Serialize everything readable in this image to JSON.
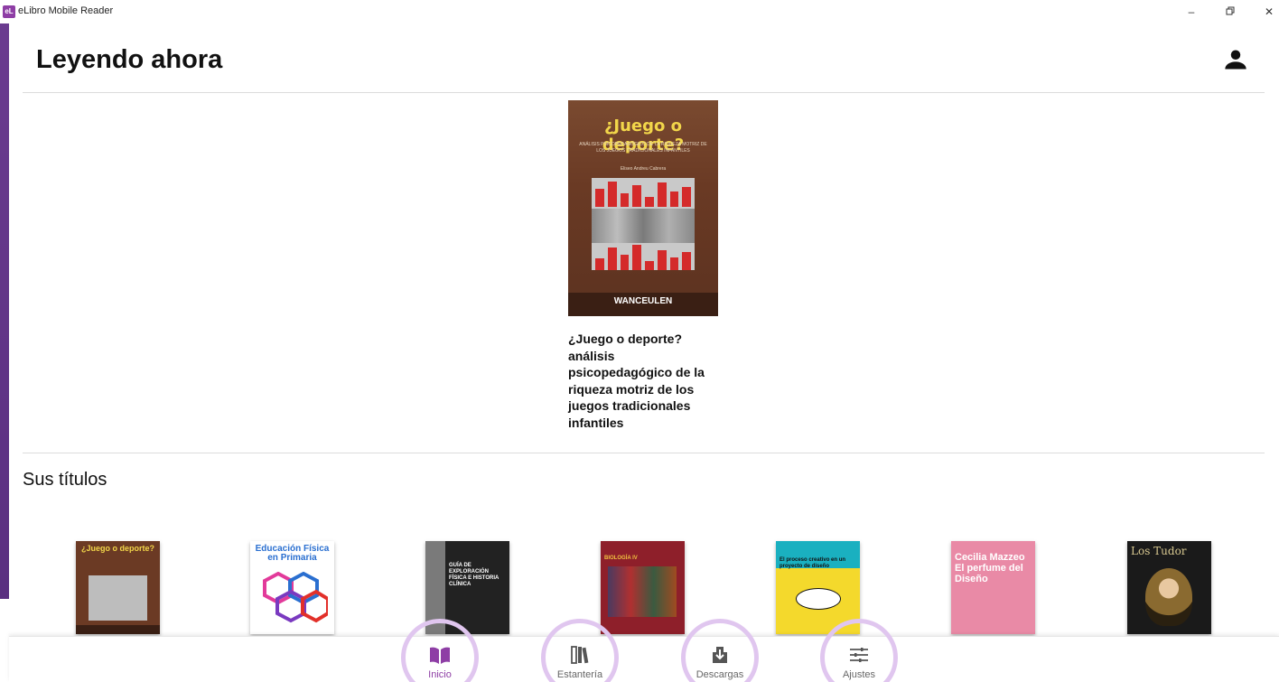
{
  "window": {
    "title": "eLibro Mobile Reader",
    "logo": "eL"
  },
  "header": {
    "title": "Leyendo ahora",
    "profile_icon": "person-icon"
  },
  "reading": {
    "cover_title": "¿Juego o deporte?",
    "cover_subtitle": "ANÁLISIS PSICOPEDAGÓGICO DE LA RIQUEZA MOTRIZ DE LOS JUEGOS TRADICIONALES INFANTILES",
    "cover_author": "Eliseo Andreu Cabrera",
    "cover_publisher": "WANCEULEN",
    "book_title": "¿Juego o deporte? análisis psicopedagógico de la riqueza motriz de los juegos tradicionales infantiles"
  },
  "titles_section": {
    "heading": "Sus títulos",
    "books": [
      {
        "cover_text": "¿Juego o deporte?",
        "color": "#6b3a24",
        "text_color": "#f2d64a"
      },
      {
        "cover_text": "Educación Física en Primaria",
        "color": "#ffffff",
        "text_color": "#2a6fd0"
      },
      {
        "cover_text": "GUÍA DE EXPLORACIÓN FÍSICA E HISTORIA CLÍNICA",
        "color": "#222222",
        "text_color": "#ffffff"
      },
      {
        "cover_text": "BIOLOGÍA IV",
        "color": "#8e1f2a",
        "text_color": "#f0c040"
      },
      {
        "cover_text": "El proceso creativo en un proyecto de diseño",
        "color": "#f4d92c",
        "text_color": "#111111"
      },
      {
        "cover_text": "Cecilia Mazzeo El perfume del Diseño",
        "color": "#e98aa6",
        "text_color": "#ffffff"
      },
      {
        "cover_text": "Los Tudor",
        "color": "#1a1a1a",
        "text_color": "#d8c890"
      }
    ]
  },
  "nav": {
    "items": [
      {
        "label": "Inicio",
        "icon": "book-open-icon",
        "active": true
      },
      {
        "label": "Estantería",
        "icon": "bookshelf-icon",
        "active": false
      },
      {
        "label": "Descargas",
        "icon": "download-icon",
        "active": false
      },
      {
        "label": "Ajustes",
        "icon": "sliders-icon",
        "active": false
      }
    ],
    "accent": "#8e3ea5",
    "ring_color": "#e0c6ef"
  }
}
